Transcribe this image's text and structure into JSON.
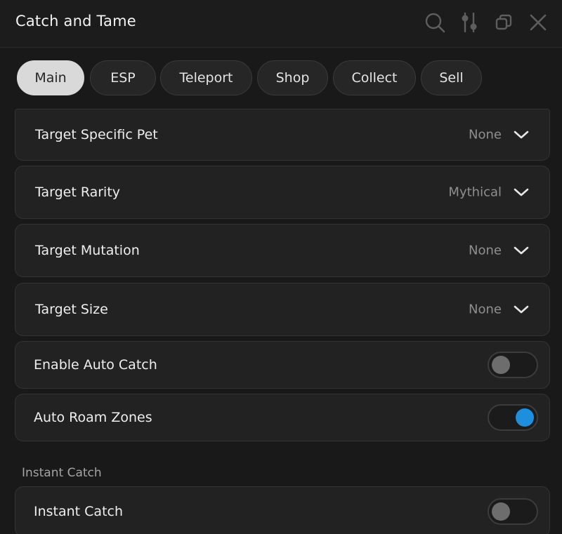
{
  "window": {
    "title": "Catch and Tame",
    "icons": [
      "search-icon",
      "sliders-icon",
      "restore-window-icon",
      "close-icon"
    ]
  },
  "tabs": [
    {
      "label": "Main",
      "active": true
    },
    {
      "label": "ESP",
      "active": false
    },
    {
      "label": "Teleport",
      "active": false
    },
    {
      "label": "Shop",
      "active": false
    },
    {
      "label": "Collect",
      "active": false
    },
    {
      "label": "Sell",
      "active": false
    }
  ],
  "dropdowns": [
    {
      "label": "Target Specific Pet",
      "value": "None"
    },
    {
      "label": "Target Rarity",
      "value": "Mythical"
    },
    {
      "label": "Target Mutation",
      "value": "None"
    },
    {
      "label": "Target Size",
      "value": "None"
    }
  ],
  "toggles": [
    {
      "label": "Enable Auto Catch",
      "on": false
    },
    {
      "label": "Auto Roam Zones",
      "on": true
    }
  ],
  "sections": [
    {
      "title": "Instant Catch",
      "toggles": [
        {
          "label": "Instant Catch",
          "on": false
        }
      ]
    }
  ],
  "colors": {
    "accent": "#1e8fdc",
    "background": "#191919",
    "row_background": "#222222",
    "active_tab": "#d9d9d9"
  }
}
